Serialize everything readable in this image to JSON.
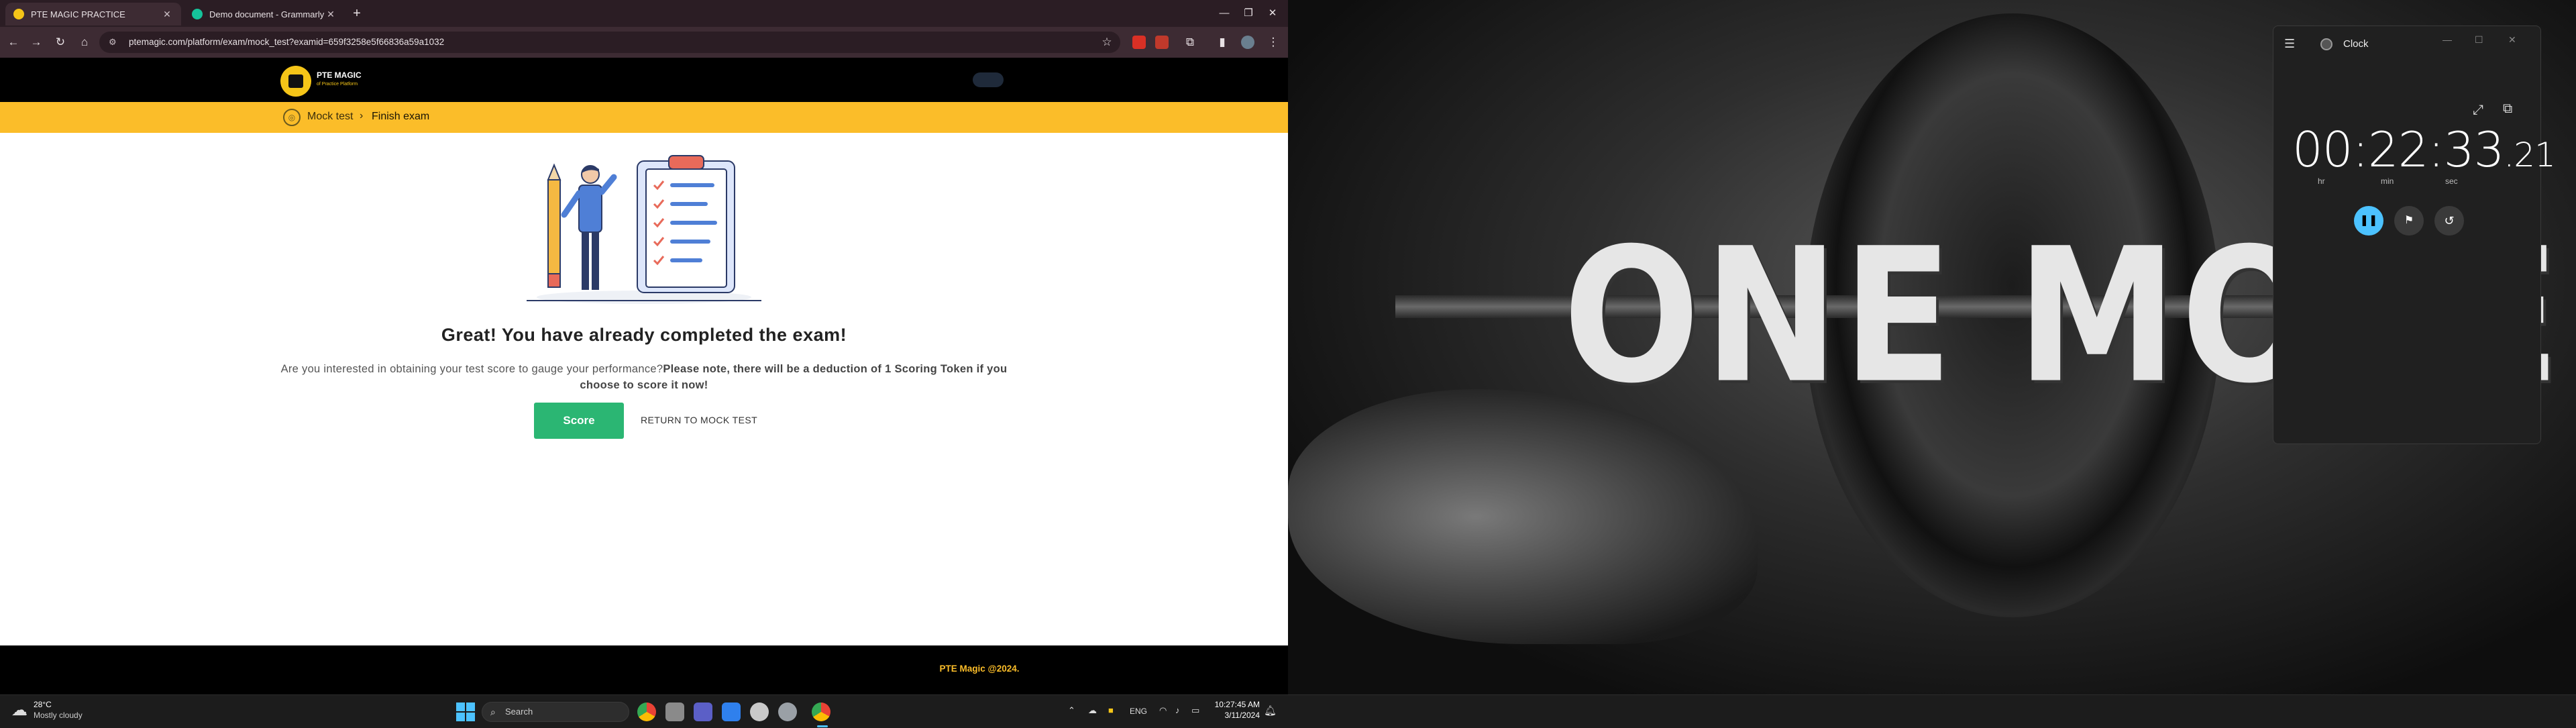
{
  "browser": {
    "tabs": [
      {
        "label": "PTE MAGIC PRACTICE",
        "active": true,
        "favicon_color": "#f5c518"
      },
      {
        "label": "Demo document - Grammarly",
        "active": false,
        "favicon_color": "#15c39a"
      }
    ],
    "url": "ptemagic.com/platform/exam/mock_test?examid=659f3258e5f66836a59a1032"
  },
  "site": {
    "logo_title": "PTE MAGIC",
    "logo_subtitle": "of Practice Platform",
    "breadcrumb": {
      "mock_test": "Mock test",
      "separator": "›",
      "current": "Finish exam"
    },
    "heading": "Great! You have already completed the exam!",
    "message_plain": "Are you interested in obtaining your test score to gauge your performance?",
    "message_bold": "Please note, there will be a deduction of 1 Scoring Token if you choose to score it now!",
    "score_button": "Score",
    "return_link": "RETURN TO MOCK TEST",
    "footer": "PTE Magic @2024."
  },
  "wallpaper": {
    "text": "ONE MORE"
  },
  "clock": {
    "title": "Clock",
    "hours": "00",
    "minutes": "22",
    "seconds": "33",
    "centiseconds": ".21",
    "unit_hr": "hr",
    "unit_min": "min",
    "unit_sec": "sec",
    "state": "running"
  },
  "taskbar": {
    "weather_temp": "28°C",
    "weather_desc": "Mostly cloudy",
    "search_placeholder": "Search",
    "language": "ENG",
    "time": "10:27:45 AM",
    "date": "3/11/2024"
  },
  "colors": {
    "accent_yellow": "#fbbd29",
    "score_green": "#2bb673",
    "clock_accent": "#4cc2ff",
    "browser_frame": "#3d2b33"
  }
}
